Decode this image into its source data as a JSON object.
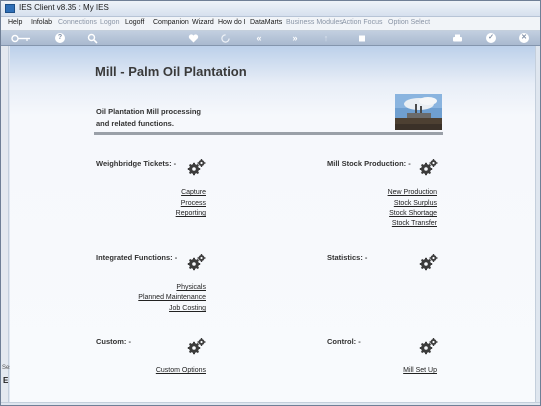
{
  "window": {
    "title": "IES Client v8.35 : My IES"
  },
  "menu": [
    {
      "label": "Help",
      "enabled": true
    },
    {
      "label": "Infolab",
      "enabled": true
    },
    {
      "label": "Connections",
      "enabled": false
    },
    {
      "label": "Logon",
      "enabled": false
    },
    {
      "label": "Logoff",
      "enabled": true
    },
    {
      "label": "Companion",
      "enabled": true
    },
    {
      "label": "Wizard",
      "enabled": true
    },
    {
      "label": "How do I",
      "enabled": true
    },
    {
      "label": "DataMarts",
      "enabled": true
    },
    {
      "label": "Business Modules",
      "enabled": false
    },
    {
      "label": "Action Focus",
      "enabled": false
    },
    {
      "label": "Option Select",
      "enabled": false
    }
  ],
  "toolbar": {
    "icons": [
      "key-icon",
      "help-icon",
      "search-icon",
      "heart-icon",
      "refresh-icon",
      "back-icon",
      "forward-icon",
      "up-icon",
      "stop-icon",
      "print-icon",
      "ok-icon",
      "close-icon"
    ]
  },
  "left_strip": {
    "label1": "Ses",
    "label2": "E"
  },
  "page": {
    "title": "Mill - Palm Oil Plantation",
    "subtitle_line1": "Oil Plantation Mill processing",
    "subtitle_line2": "and related functions."
  },
  "sections": {
    "weighbridge": {
      "heading": "Weighbridge Tickets: -",
      "links": [
        "Capture",
        "Process",
        "Reporting"
      ]
    },
    "mill_stock": {
      "heading": "Mill Stock Production: -",
      "links": [
        "New Production",
        "Stock Surplus",
        "Stock Shortage",
        "Stock Transfer"
      ]
    },
    "integrated": {
      "heading": "Integrated Functions: -",
      "links": [
        "Physicals",
        "Planned Maintenance",
        "Job Costing"
      ]
    },
    "statistics": {
      "heading": "Statistics: -",
      "links": []
    },
    "custom": {
      "heading": "Custom: -",
      "links": [
        "Custom Options"
      ]
    },
    "control": {
      "heading": "Control: -",
      "links": [
        "Mill Set Up"
      ]
    }
  },
  "colors": {
    "toolbar": "#a9b9cf",
    "content_top": "#bcd0ea",
    "content_bg": "#f8fafd",
    "divider": "#9aa0a8",
    "gear": "#3c3c3c"
  }
}
